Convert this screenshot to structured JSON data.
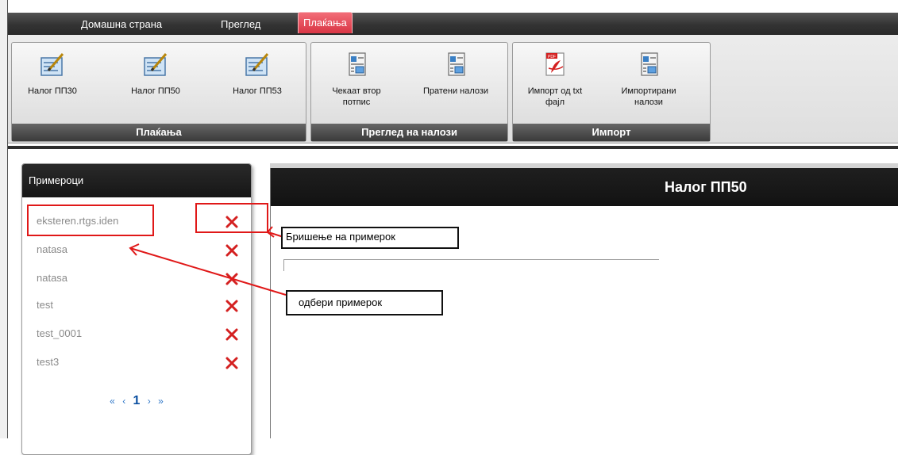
{
  "tabs": [
    {
      "label": "Домашна страна",
      "active": false
    },
    {
      "label": "Преглед",
      "active": false
    },
    {
      "label": "Плаќања",
      "active": true
    }
  ],
  "ribbon": {
    "groups": [
      {
        "title": "Плаќања",
        "buttons": [
          {
            "label": "Налог ПП30",
            "icon": "edit-form-icon"
          },
          {
            "label": "Налог ПП50",
            "icon": "edit-form-icon"
          },
          {
            "label": "Налог ПП53",
            "icon": "edit-form-icon"
          }
        ]
      },
      {
        "title": "Преглед на налози",
        "buttons": [
          {
            "label": "Чекаат втор потпис",
            "icon": "document-list-icon"
          },
          {
            "label": "Пратени налози",
            "icon": "document-list-icon"
          }
        ]
      },
      {
        "title": "Импорт",
        "buttons": [
          {
            "label": "Импорт од txt фајл",
            "icon": "pdf-document-icon"
          },
          {
            "label": "Импортирани налози",
            "icon": "document-list-icon"
          }
        ]
      }
    ]
  },
  "samples": {
    "title": "Примероци",
    "items": [
      "eksteren.rtgs.iden",
      "natasa",
      "natasa",
      "test",
      "test_0001",
      "test3"
    ],
    "delete_icon": "delete-x-icon",
    "pager": {
      "first": "«",
      "prev": "‹",
      "current": "1",
      "next": "›",
      "last": "»"
    }
  },
  "main": {
    "title": "Налог ПП50"
  },
  "annotations": {
    "delete_label": "Бришење на примерок",
    "select_label": "одбери примерок"
  },
  "colors": {
    "active_tab": "#e03a48",
    "annotation_red": "#e01818",
    "delete_icon": "#d42020",
    "pager_link": "#2d76c8"
  }
}
